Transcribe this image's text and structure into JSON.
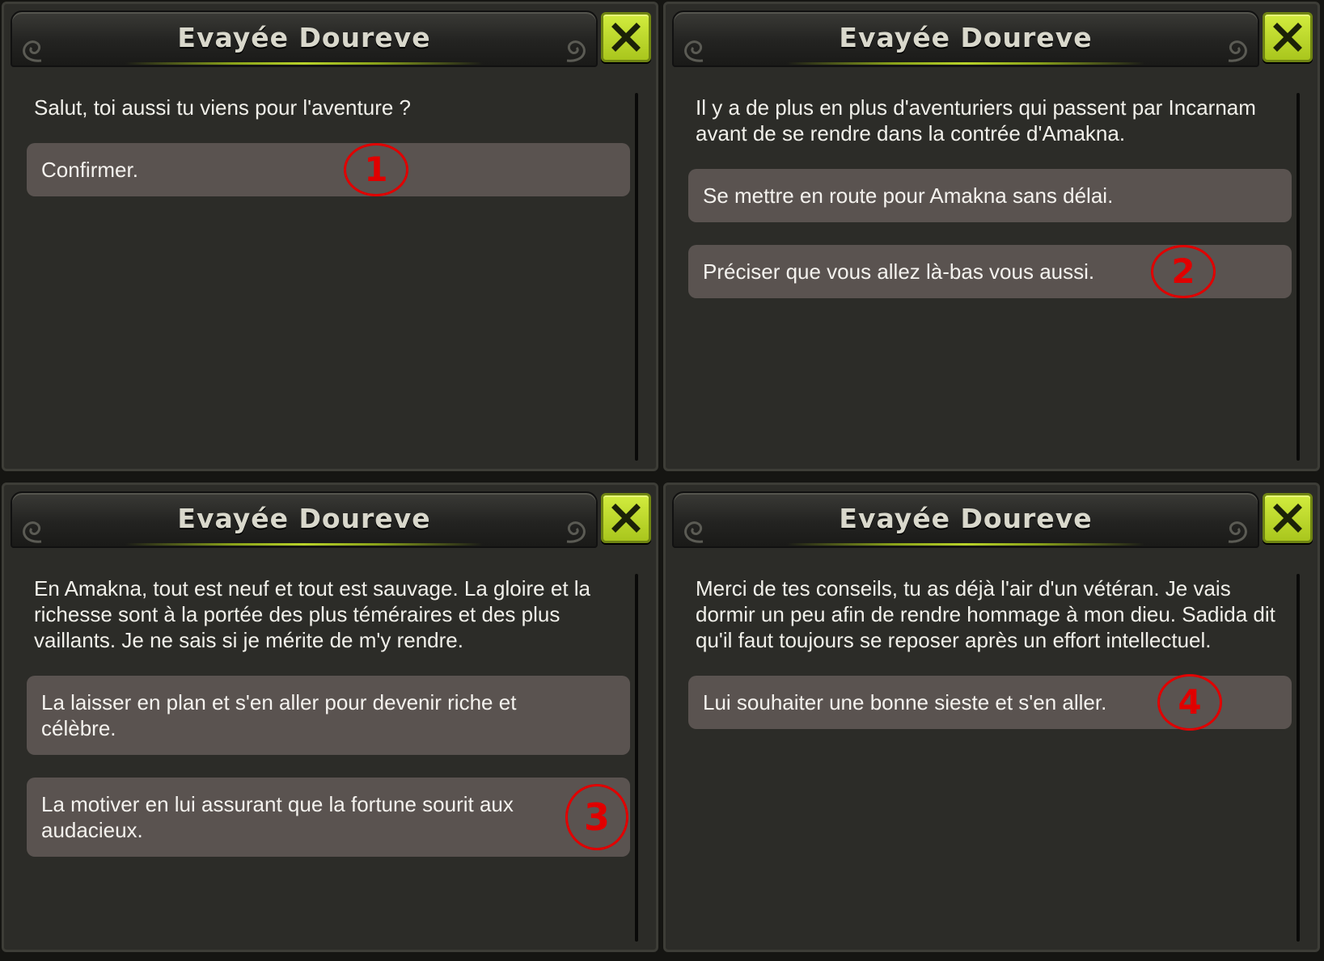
{
  "colors": {
    "panel_bg": "#2c2c28",
    "option_bg": "#5a5350",
    "close_button": "#bcd82b",
    "accent_line": "#b8d22a",
    "marker": "#e00000"
  },
  "icons": {
    "close": "close-x-icon",
    "title_ornament": "swirl-ornament-icon"
  },
  "panels": [
    {
      "title": "Evayée Doureve",
      "message": "Salut, toi aussi tu viens pour l'aventure ?",
      "options": [
        {
          "label": "Confirmer.",
          "marker": "1"
        }
      ]
    },
    {
      "title": "Evayée Doureve",
      "message": "Il y a de plus en plus d'aventuriers qui passent par Incarnam avant de se rendre dans la contrée d'Amakna.",
      "options": [
        {
          "label": "Se mettre en route pour Amakna sans délai.",
          "marker": ""
        },
        {
          "label": "Préciser que vous allez là-bas vous aussi.",
          "marker": "2"
        }
      ]
    },
    {
      "title": "Evayée Doureve",
      "message": "En Amakna, tout est neuf et tout est sauvage. La gloire et la richesse sont à la portée des plus téméraires et des plus vaillants. Je ne sais si je mérite de m'y rendre.",
      "options": [
        {
          "label": "La laisser en plan et s'en aller pour devenir riche et célèbre.",
          "marker": ""
        },
        {
          "label": "La motiver en lui assurant que la fortune sourit aux audacieux.",
          "marker": "3"
        }
      ]
    },
    {
      "title": "Evayée Doureve",
      "message": "Merci de tes conseils, tu as déjà l'air d'un vétéran. Je vais dormir un peu afin de rendre hommage à mon dieu. Sadida dit qu'il faut toujours se reposer après un effort intellectuel.",
      "options": [
        {
          "label": "Lui souhaiter une bonne sieste et s'en aller.",
          "marker": "4"
        }
      ]
    }
  ]
}
